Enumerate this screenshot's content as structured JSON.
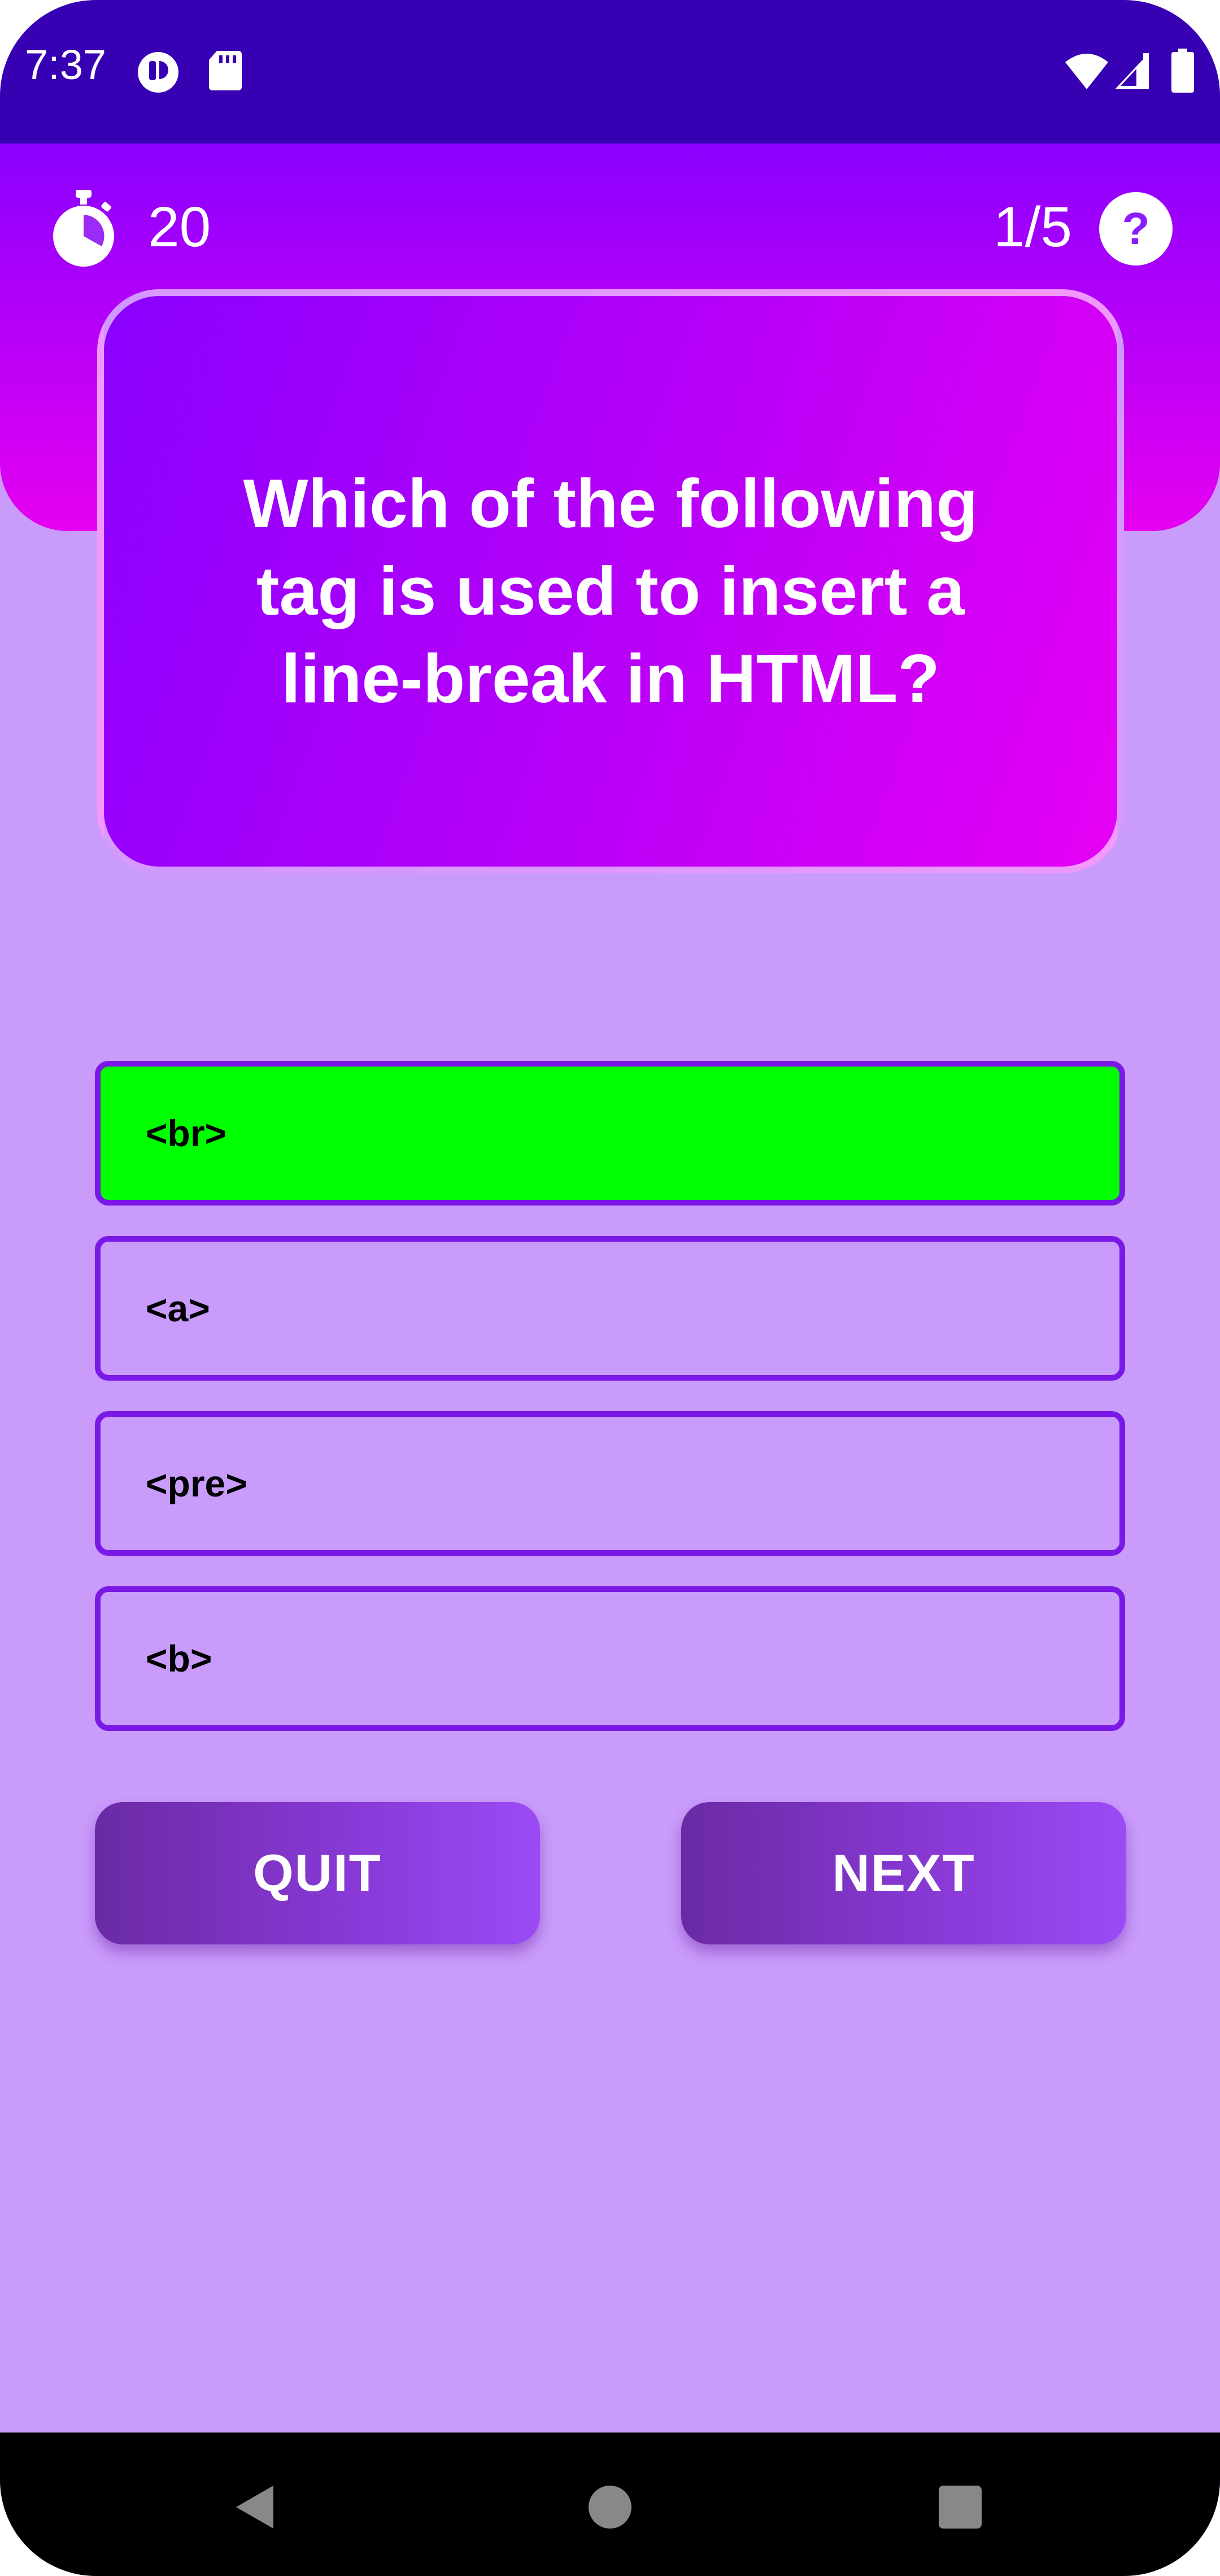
{
  "status_bar": {
    "time": "7:37",
    "background_color": "#3700b3",
    "icons": [
      "app-notification-icon",
      "sd-card-icon",
      "wifi-icon",
      "cellular-signal-icon",
      "battery-icon"
    ]
  },
  "header": {
    "timer_icon": "stopwatch-icon",
    "timer_value": "20",
    "progress": "1/5",
    "help_icon": "help-icon",
    "help_symbol": "?",
    "gradient_colors": [
      "#8a00ff",
      "#e600f0"
    ]
  },
  "question": {
    "text": "Which of the following tag is used to insert a line-break in HTML?"
  },
  "options": [
    {
      "label": "<br>",
      "selected": true
    },
    {
      "label": "<a>",
      "selected": false
    },
    {
      "label": "<pre>",
      "selected": false
    },
    {
      "label": "<b>",
      "selected": false
    }
  ],
  "buttons": {
    "quit": "QUIT",
    "next": "NEXT"
  },
  "colors": {
    "page_background": "#c99bfb",
    "option_border": "#7a18e6",
    "selected_option": "#00ff00"
  },
  "nav_bar": {
    "icons": [
      "back-icon",
      "home-icon",
      "recents-icon"
    ]
  }
}
